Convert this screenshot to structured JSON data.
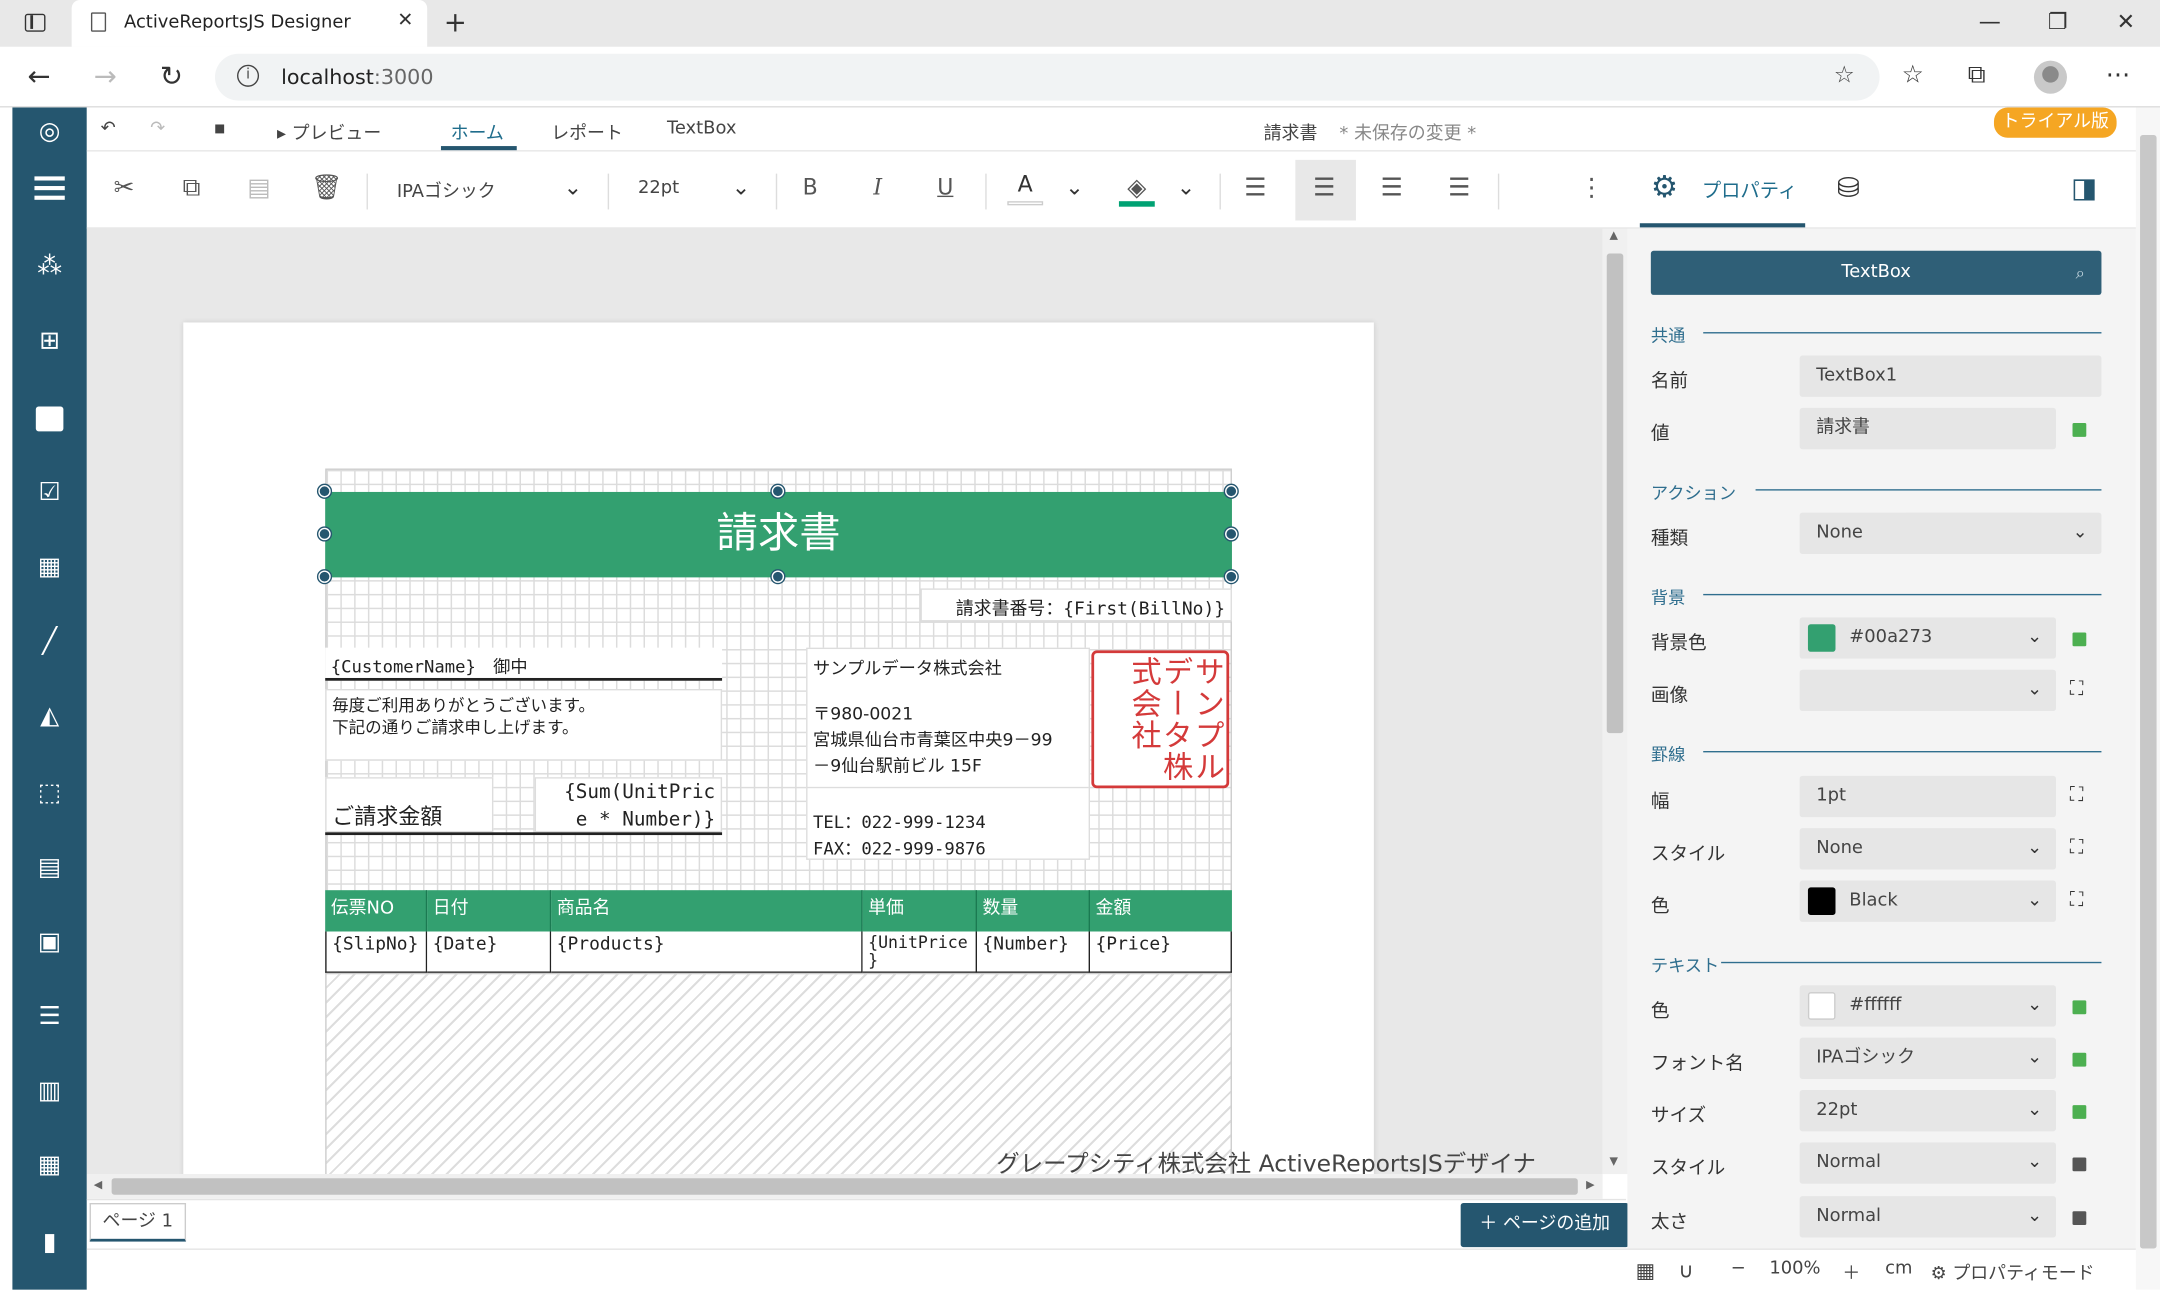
{
  "browser": {
    "tab_title": "ActiveReportsJS Designer",
    "tab_close": "✕",
    "new_tab": "+",
    "url_host": "localhost",
    "url_port": ":3000",
    "window_controls": [
      "—",
      "❐",
      "✕"
    ]
  },
  "menu": {
    "preview": "プレビュー",
    "home": "ホーム",
    "report": "レポート",
    "textbox": "TextBox",
    "doc_title": "請求書",
    "unsaved": "* 未保存の変更 *",
    "trial": "トライアル版"
  },
  "toolbar": {
    "font": "IPAゴシック",
    "size": "22pt",
    "bold": "B",
    "italic": "I",
    "underline": "U",
    "color_a": "A",
    "accent": "#00a273"
  },
  "properties_tab": {
    "label": "プロパティ"
  },
  "report": {
    "title": "請求書",
    "bill_no": "請求書番号：{First(BillNo)}",
    "customer": "{CustomerName}　御中",
    "greeting_1": "毎度ご利用ありがとうございます。",
    "greeting_2": "下記の通りご請求申し上げます。",
    "amount_label": "ご請求金額",
    "amount_expr_1": "{Sum(UnitPric",
    "amount_expr_2": "e * Number)}",
    "company": "サンプルデータ株式会社",
    "postal": "〒980-0021",
    "address_1": "宮城県仙台市青葉区中央9－99",
    "address_2": "－9仙台駅前ビル 15F",
    "tel": "TEL：022-999-1234",
    "fax": "FAX：022-999-9876",
    "stamp": "サンプルデータ株式会社",
    "headers": [
      "伝票NO",
      "日付",
      "商品名",
      "単価",
      "数量",
      "金額"
    ],
    "details": [
      "{SlipNo}",
      "{Date}",
      "{Products}",
      "{UnitPrice",
      "{Number}",
      "{Price}"
    ],
    "detail_overflow": "}",
    "watermark": "グレープシティ株式会社 ActiveReportsJSデザイナ"
  },
  "bottom": {
    "page_tab": "ページ 1",
    "add_page": "ページの追加",
    "zoom": "100%",
    "unit": "cm",
    "prop_mode": "プロパティモード"
  },
  "panel": {
    "search": "TextBox",
    "sections": {
      "common": "共通",
      "action": "アクション",
      "background": "背景",
      "border": "罫線",
      "text": "テキスト"
    },
    "name_label": "名前",
    "name_value": "TextBox1",
    "value_label": "値",
    "value_value": "請求書",
    "kind_label": "種類",
    "kind_value": "None",
    "bgcolor_label": "背景色",
    "bgcolor_value": "#00a273",
    "image_label": "画像",
    "width_label": "幅",
    "width_value": "1pt",
    "style_label": "スタイル",
    "style_value": "None",
    "color_label": "色",
    "color_value": "Black",
    "text_color_label": "色",
    "text_color_value": "#ffffff",
    "font_label": "フォント名",
    "font_value": "IPAゴシック",
    "size_label": "サイズ",
    "size_value": "22pt",
    "tstyle_label": "スタイル",
    "tstyle_value": "Normal",
    "weight_label": "太さ",
    "weight_value": "Normal"
  }
}
